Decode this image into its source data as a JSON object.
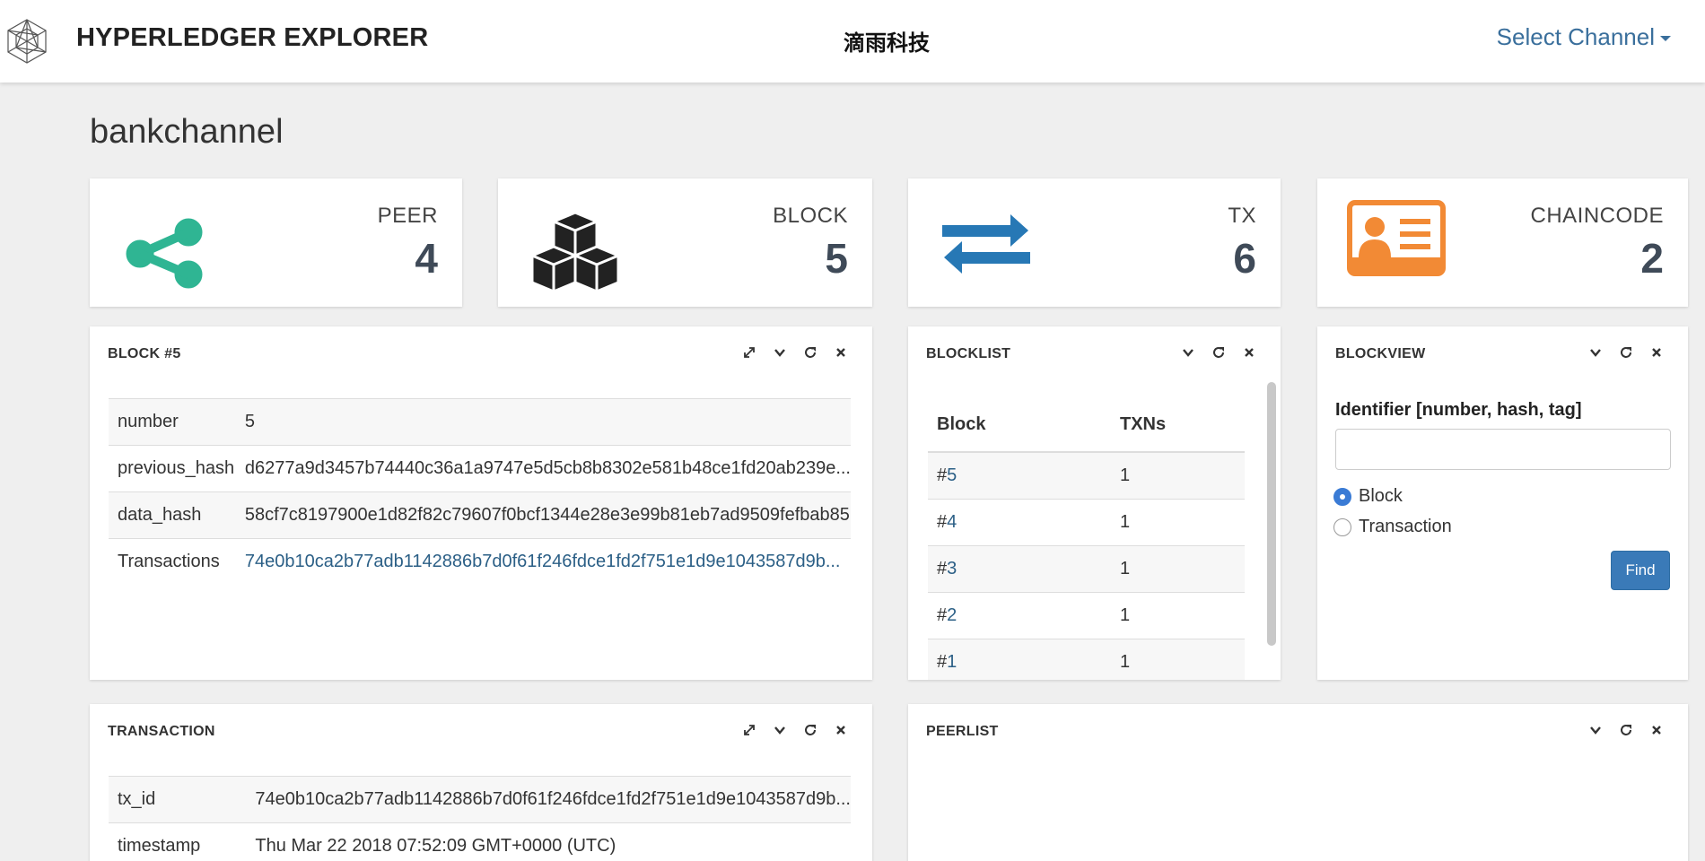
{
  "navbar": {
    "brand": "HYPERLEDGER EXPLORER",
    "center_title": "滴雨科技",
    "select_channel": "Select Channel"
  },
  "page_title": "bankchannel",
  "stats": {
    "peer": {
      "label": "PEER",
      "value": "4"
    },
    "block": {
      "label": "BLOCK",
      "value": "5"
    },
    "tx": {
      "label": "TX",
      "value": "6"
    },
    "chaincode": {
      "label": "CHAINCODE",
      "value": "2"
    }
  },
  "colors": {
    "peer": "#2fb593",
    "block": "#222222",
    "tx": "#2778b5",
    "chaincode": "#f28a35",
    "link": "#2b5f86"
  },
  "block_panel": {
    "title": "BLOCK #5",
    "rows": [
      {
        "key": "number",
        "value": "5"
      },
      {
        "key": "previous_hash",
        "value": "d6277a9d3457b74440c36a1a9747e5d5cb8b8302e581b48ce1fd20ab239e..."
      },
      {
        "key": "data_hash",
        "value": "58cf7c8197900e1d82f82c79607f0bcf1344e28e3e99b81eb7ad9509fefbab85"
      },
      {
        "key": "Transactions",
        "value": "74e0b10ca2b77adb1142886b7d0f61f246fdce1fd2f751e1d9e1043587d9b..."
      }
    ]
  },
  "blocklist_panel": {
    "title": "BLOCKLIST",
    "headers": {
      "block": "Block",
      "txns": "TXNs"
    },
    "rows": [
      {
        "hash": "#",
        "num": "5",
        "txns": "1"
      },
      {
        "hash": "#",
        "num": "4",
        "txns": "1"
      },
      {
        "hash": "#",
        "num": "3",
        "txns": "1"
      },
      {
        "hash": "#",
        "num": "2",
        "txns": "1"
      },
      {
        "hash": "#",
        "num": "1",
        "txns": "1"
      }
    ]
  },
  "blockview_panel": {
    "title": "BLOCKVIEW",
    "identifier_label": "Identifier [number, hash, tag]",
    "identifier_value": "",
    "radio_block": "Block",
    "radio_transaction": "Transaction",
    "find": "Find"
  },
  "transaction_panel": {
    "title": "TRANSACTION",
    "rows": [
      {
        "key": "tx_id",
        "value": "74e0b10ca2b77adb1142886b7d0f61f246fdce1fd2f751e1d9e1043587d9b..."
      },
      {
        "key": "timestamp",
        "value": "Thu Mar 22 2018 07:52:09 GMT+0000 (UTC)"
      }
    ]
  },
  "peerlist_panel": {
    "title": "PEERLIST"
  }
}
